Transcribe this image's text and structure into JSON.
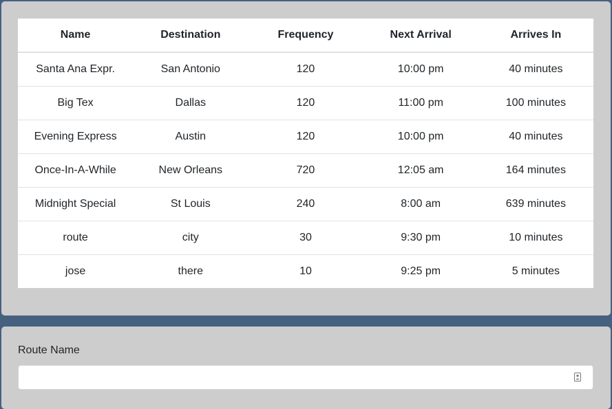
{
  "schedule": {
    "columns": [
      "Name",
      "Destination",
      "Frequency",
      "Next Arrival",
      "Arrives In"
    ],
    "rows": [
      [
        "Santa Ana Expr.",
        "San Antonio",
        "120",
        "10:00 pm",
        "40 minutes"
      ],
      [
        "Big Tex",
        "Dallas",
        "120",
        "11:00 pm",
        "100 minutes"
      ],
      [
        "Evening Express",
        "Austin",
        "120",
        "10:00 pm",
        "40 minutes"
      ],
      [
        "Once-In-A-While",
        "New Orleans",
        "720",
        "12:05 am",
        "164 minutes"
      ],
      [
        "Midnight Special",
        "St Louis",
        "240",
        "8:00 am",
        "639 minutes"
      ],
      [
        "route",
        "city",
        "30",
        "9:30 pm",
        "10 minutes"
      ],
      [
        "jose",
        "there",
        "10",
        "9:25 pm",
        "5 minutes"
      ]
    ]
  },
  "form": {
    "route_name_label": "Route Name",
    "route_name_value": "",
    "route_name_icon": "contact-card-icon"
  },
  "colors": {
    "page_background": "#46607f",
    "panel_background": "#cdcdcd",
    "table_background": "#ffffff"
  }
}
